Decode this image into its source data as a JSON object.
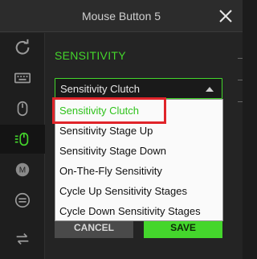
{
  "window": {
    "title": "Mouse Button 5"
  },
  "sidebar": {
    "items": [
      {
        "icon": "refresh-icon"
      },
      {
        "icon": "keyboard-icon"
      },
      {
        "icon": "mouse-icon"
      },
      {
        "icon": "mouse-sensitivity-icon",
        "active": true
      },
      {
        "icon": "macro-icon",
        "label": "M"
      },
      {
        "icon": "switch-profile-icon"
      },
      {
        "icon": "swap-icon"
      }
    ]
  },
  "main": {
    "section_title": "SENSITIVITY",
    "select": {
      "value": "Sensitivity Clutch"
    },
    "dropdown": {
      "options": [
        "Sensitivity Clutch",
        "Sensitivity Stage Up",
        "Sensitivity Stage Down",
        "On-The-Fly Sensitivity",
        "Cycle Up Sensitivity Stages",
        "Cycle Down Sensitivity Stages"
      ],
      "selected_index": 0
    },
    "buttons": {
      "cancel": "CANCEL",
      "save": "SAVE"
    }
  },
  "colors": {
    "accent": "#44d62c",
    "highlight": "#e0242a"
  }
}
